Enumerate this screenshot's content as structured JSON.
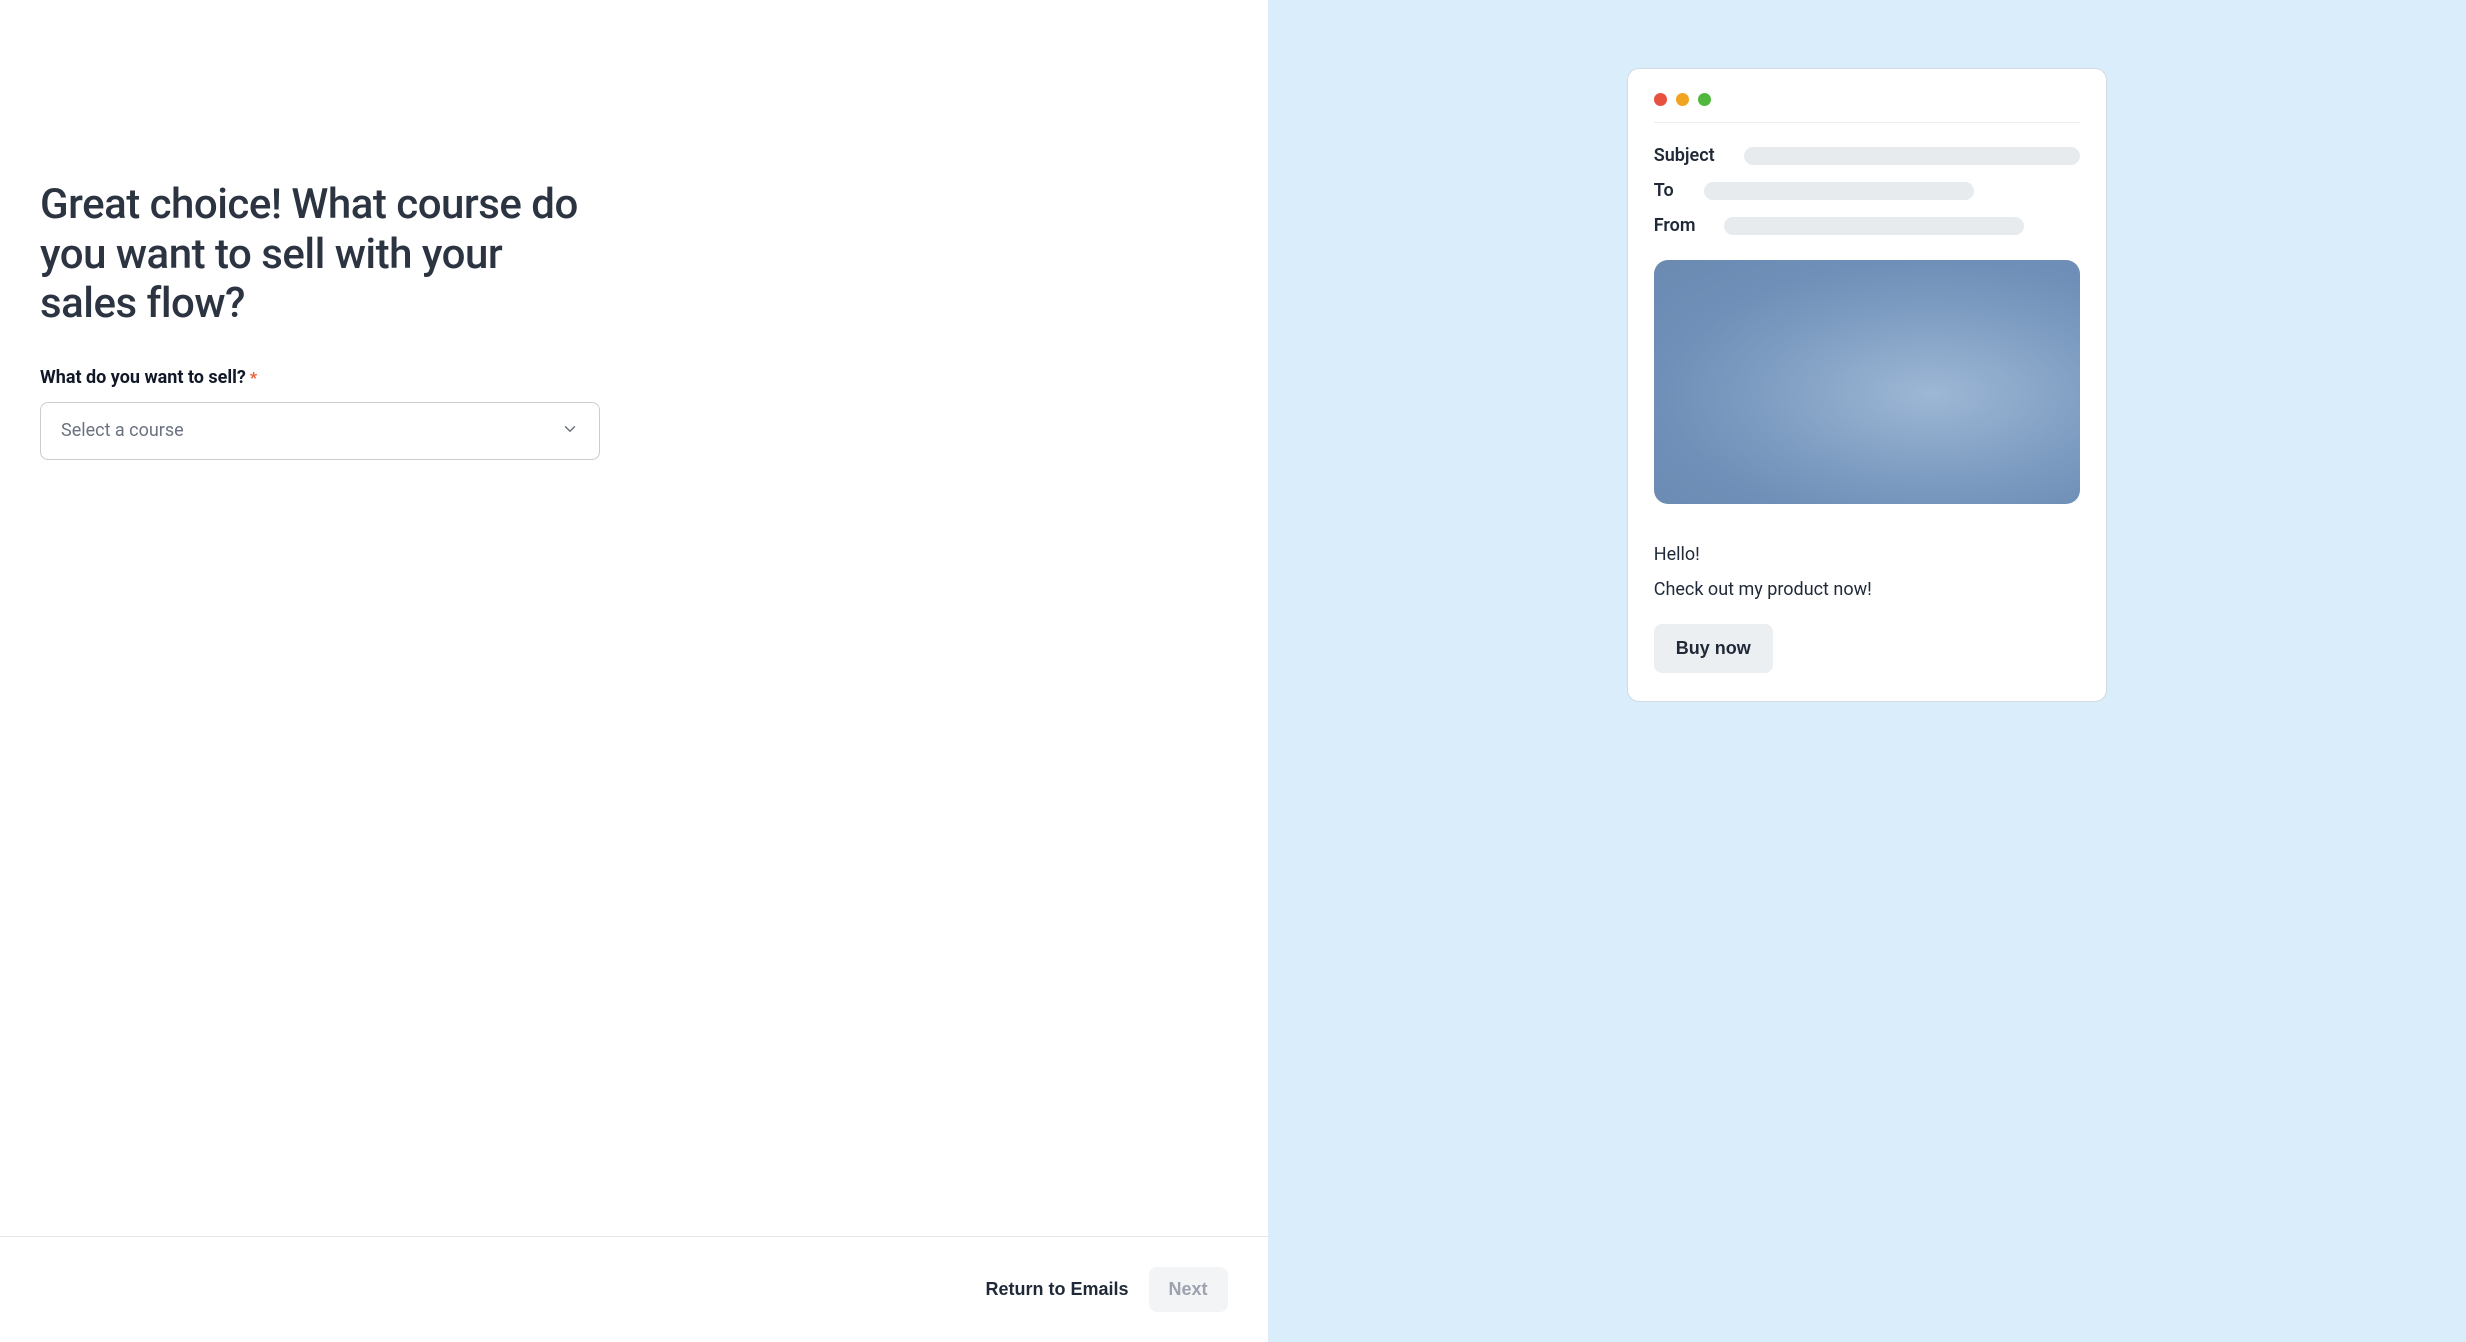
{
  "left": {
    "headline": "Great choice! What course do you want to sell with your sales flow?",
    "field": {
      "label": "What do you want to sell?",
      "required_marker": "*",
      "placeholder": "Select a course"
    },
    "footer": {
      "return_label": "Return to Emails",
      "next_label": "Next"
    }
  },
  "preview": {
    "meta": {
      "subject_label": "Subject",
      "to_label": "To",
      "from_label": "From"
    },
    "body": {
      "greeting": "Hello!",
      "line": "Check out my product now!",
      "cta": "Buy now"
    },
    "traffic_colors": {
      "red": "#e8513f",
      "yellow": "#f0a41f",
      "green": "#4fb83d"
    }
  }
}
